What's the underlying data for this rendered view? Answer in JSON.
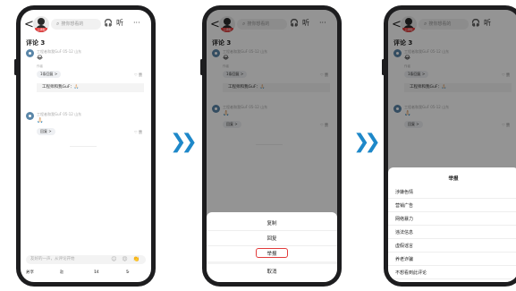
{
  "header": {
    "back": "<",
    "search_placeholder": "搜你想看的",
    "avatar_tag": "上线啦",
    "listen_label": "听",
    "more_label": "···"
  },
  "comments_title": "评论 3",
  "comment1": {
    "name": "工程者和我GuF 05-12 山东",
    "emoji": "😂",
    "small_note": "作者",
    "reply_pill": "1条回复 >",
    "like": "♡ 赞",
    "reply_text": "工程师和我GuF：🙏🏻",
    "reply_pill_p2": "1条回复 >"
  },
  "comment2": {
    "name": "工程者和我GuF 05-12 山东",
    "emoji": "🙏🏻",
    "reply_pill": "回复 >",
    "like": "♡ 赞"
  },
  "input_placeholder": "友好的一声，从评论开始",
  "input_emojis": "😊 😍 👏",
  "actions": {
    "share": "分享",
    "comment": "3",
    "like": "14",
    "fav": "5"
  },
  "menu": {
    "copy": "复制",
    "reply": "回复",
    "report": "举报",
    "cancel": "取消"
  },
  "report": {
    "title": "举报",
    "reasons": [
      "涉嫌色情",
      "营销广告",
      "网络暴力",
      "违法信息",
      "虚假谣言",
      "养老诈骗",
      "不想看到此评论"
    ]
  },
  "arrows": [
    "❯❯",
    "❯❯"
  ],
  "colors": {
    "arrow": "#1e88c9",
    "highlight": "#e23b3b",
    "dim": "rgba(0,0,0,0.42)"
  }
}
